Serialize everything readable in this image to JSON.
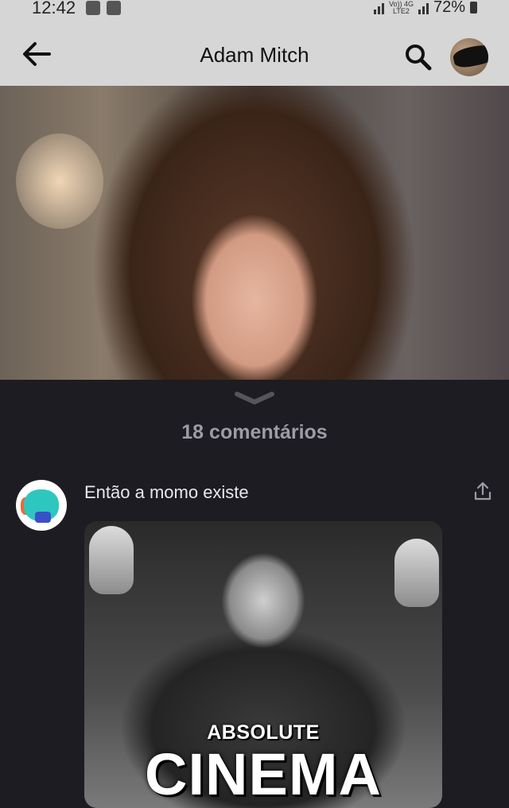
{
  "status_bar": {
    "time": "12:42",
    "battery_percent": "72%",
    "network_label_top": "Vo)) 4G",
    "network_label_bottom": "LTE2"
  },
  "header": {
    "title": "Adam Mitch",
    "back_icon": "arrow-left-icon",
    "search_icon": "search-icon"
  },
  "comments": {
    "count_label": "18 comentários",
    "items": [
      {
        "text": "Então a momo existe",
        "meme_caption_top": "ABSOLUTE",
        "meme_caption_bottom": "CINEMA"
      }
    ]
  },
  "colors": {
    "header_bg": "#d6d6d6",
    "sheet_bg": "#1c1c22",
    "count_text": "#9c9ca4",
    "comment_text": "#e8e8ec"
  }
}
